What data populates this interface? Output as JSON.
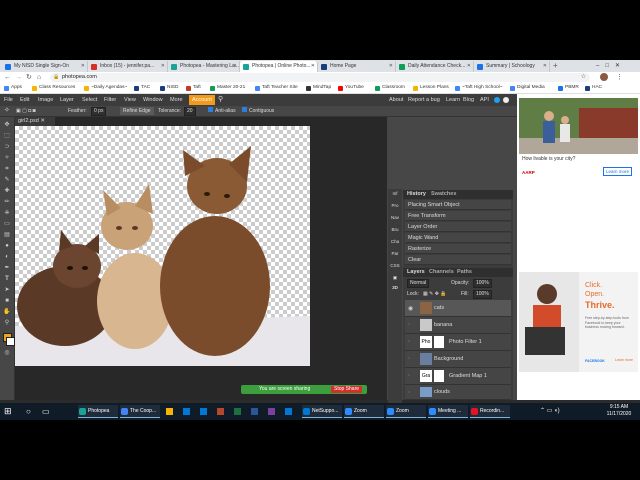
{
  "browser": {
    "tabs": [
      {
        "label": "My NISD Single Sign-On",
        "color": "#1a73e8"
      },
      {
        "label": "Inbox (15) - jennifer.pa...",
        "color": "#d93025"
      },
      {
        "label": "Photopea - Mastering La...",
        "color": "#18a497"
      },
      {
        "label": "Photopea | Online Photo...",
        "color": "#18a497",
        "active": true
      },
      {
        "label": "Home Page",
        "color": "#1a3d7c"
      },
      {
        "label": "Daily Attendance Check...",
        "color": "#0f9d58"
      },
      {
        "label": "Summary | Schoology",
        "color": "#1a73e8"
      }
    ],
    "url": "photopea.com",
    "bookmarks": [
      {
        "label": "Apps",
        "color": "#4285f4"
      },
      {
        "label": "Class Resources",
        "color": "#f4b400"
      },
      {
        "label": "~Daily Agendas~",
        "color": "#f4b400"
      },
      {
        "label": "TAC",
        "color": "#1a3d7c"
      },
      {
        "label": "NISD",
        "color": "#1a3d7c"
      },
      {
        "label": "Taft",
        "color": "#c0392b"
      },
      {
        "label": "Master 20-21",
        "color": "#0f9d58"
      },
      {
        "label": "Taft Teacher Site",
        "color": "#4285f4"
      },
      {
        "label": "MindTap",
        "color": "#333333"
      },
      {
        "label": "YouTube",
        "color": "#ff0000"
      },
      {
        "label": "Classroom",
        "color": "#0f9d58"
      },
      {
        "label": "Lesson Plans",
        "color": "#f4b400"
      },
      {
        "label": "~Taft High School~",
        "color": "#4285f4"
      },
      {
        "label": "Digital Media",
        "color": "#4285f4"
      },
      {
        "label": "PBMR",
        "color": "#1a73e8"
      },
      {
        "label": "HAC",
        "color": "#1a3d7c"
      }
    ]
  },
  "photopea": {
    "menu": [
      "File",
      "Edit",
      "Image",
      "Layer",
      "Select",
      "Filter",
      "View",
      "Window",
      "More"
    ],
    "account": "Account",
    "right_menu": [
      "About",
      "Report a bug",
      "Learn",
      "Blog",
      "API"
    ],
    "options": {
      "feather_label": "Feather:",
      "feather_value": "0",
      "feather_unit": "px",
      "refine_edge": "Refine Edge",
      "tolerance_label": "Tolerance:",
      "tolerance_value": "20",
      "anti_alias": "Anti-alias",
      "contiguous": "Contiguous"
    },
    "doc_tab": "girl2.psd",
    "mini_panel": [
      "Inf",
      "Pro",
      "Nav",
      "Bru",
      "Cha",
      "Par",
      "CSS"
    ],
    "history": {
      "tabs": [
        "History",
        "Swatches"
      ],
      "items": [
        "Placing Smart Object",
        "Free Transform",
        "Layer Order",
        "Magic Wand",
        "Rasterize",
        "Clear"
      ]
    },
    "layers": {
      "tabs": [
        "Layers",
        "Channels",
        "Paths"
      ],
      "blend_mode": "Normal",
      "opacity_label": "Opacity:",
      "opacity_value": "100%",
      "lock_label": "Lock:",
      "fill_label": "Fill:",
      "fill_value": "100%",
      "items": [
        {
          "name": "cats"
        },
        {
          "name": "banana"
        },
        {
          "name": "Photo Filter 1",
          "badge": "Pho"
        },
        {
          "name": "Background"
        },
        {
          "name": "Gradient Map 1",
          "badge": "Gra"
        },
        {
          "name": "clouds"
        }
      ]
    },
    "share_bar": {
      "message": "You are screen sharing",
      "stop": "Stop Share"
    }
  },
  "ads": {
    "ad1_caption": "How livable is your city?",
    "ad1_brand": "AARP",
    "ad1_button": "Learn more",
    "ad2_headline_1": "Click.",
    "ad2_headline_2": "Open.",
    "ad2_headline_3": "Thrive.",
    "ad2_body": "Free step-by-step tools from Facebook to keep your business moving forward.",
    "ad2_brand": "FACEBOOK",
    "ad2_button": "Learn more"
  },
  "taskbar": {
    "items": [
      {
        "label": "Photopea",
        "color": "#18a497",
        "open": true
      },
      {
        "label": "The Coop...",
        "color": "#4285f4",
        "open": true
      },
      {
        "label": "NetSuppo...",
        "color": "#0078d7",
        "open": true
      },
      {
        "label": "Zoom",
        "color": "#2d8cff",
        "open": true
      },
      {
        "label": "Zoom",
        "color": "#2d8cff",
        "open": true
      },
      {
        "label": "Meeting ...",
        "color": "#2d8cff",
        "open": true
      },
      {
        "label": "Recordin...",
        "color": "#e81123",
        "open": true
      }
    ],
    "time": "9:15 AM",
    "date": "11/17/2020"
  }
}
